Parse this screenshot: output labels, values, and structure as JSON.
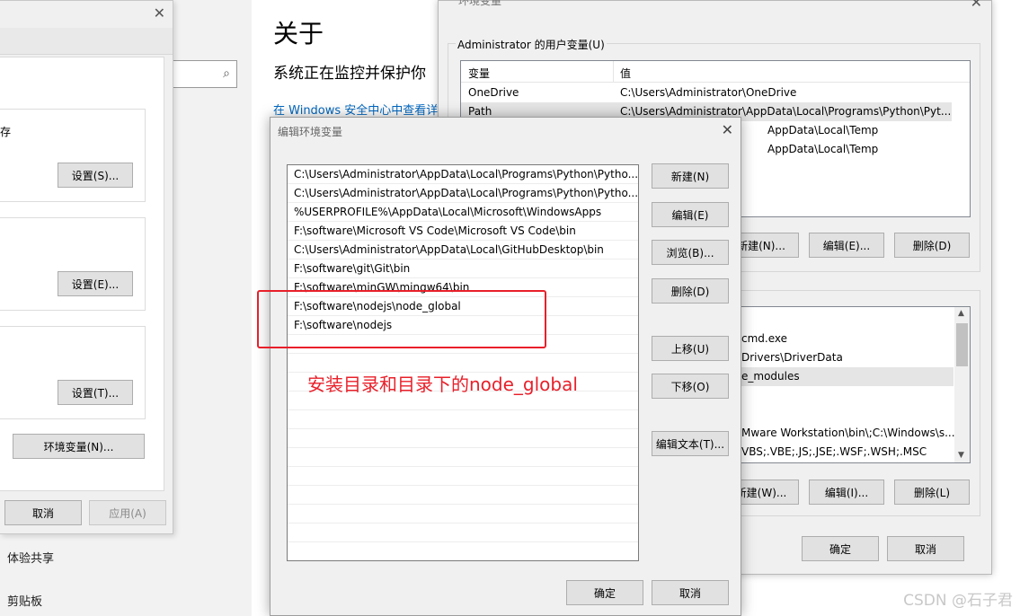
{
  "settings_left": {
    "partial_label_1": "存",
    "settings_buttons": [
      "设置(S)...",
      "设置(E)...",
      "设置(T)..."
    ],
    "env_button": "环境变量(N)...",
    "cancel": "取消",
    "apply": "应用(A)",
    "nav_items": [
      "体验共享",
      "剪贴板"
    ]
  },
  "about": {
    "title": "关于",
    "subtitle": "系统正在监控并保护你",
    "link": "在 Windows 安全中心中查看详"
  },
  "env_dialog": {
    "title": "环境变量",
    "user_vars_label": "Administrator 的用户变量(U)",
    "columns": [
      "变量",
      "值"
    ],
    "user_vars": [
      {
        "name": "OneDrive",
        "value": "C:\\Users\\Administrator\\OneDrive"
      },
      {
        "name": "Path",
        "value": "C:\\Users\\Administrator\\AppData\\Local\\Programs\\Python\\Pyt..."
      },
      {
        "name": "",
        "value": "AppData\\Local\\Temp"
      },
      {
        "name": "",
        "value": "AppData\\Local\\Temp"
      }
    ],
    "user_buttons": [
      "新建(N)...",
      "编辑(E)...",
      "删除(D)"
    ],
    "sys_vars_partial": [
      "cmd.exe",
      "Drivers\\DriverData",
      "e_modules",
      "",
      "",
      "Mware Workstation\\bin\\;C:\\Windows\\s...",
      "VBS;.VBE;.JS;.JSE;.WSF;.WSH;.MSC"
    ],
    "sys_buttons": [
      "新建(W)...",
      "编辑(I)...",
      "删除(L)"
    ],
    "ok": "确定",
    "cancel": "取消"
  },
  "edit_dialog": {
    "title": "编辑环境变量",
    "paths": [
      "C:\\Users\\Administrator\\AppData\\Local\\Programs\\Python\\Pytho...",
      "C:\\Users\\Administrator\\AppData\\Local\\Programs\\Python\\Pytho...",
      "%USERPROFILE%\\AppData\\Local\\Microsoft\\WindowsApps",
      "F:\\software\\Microsoft VS Code\\Microsoft VS Code\\bin",
      "C:\\Users\\Administrator\\AppData\\Local\\GitHubDesktop\\bin",
      "F:\\software\\git\\Git\\bin",
      "F:\\software\\minGW\\mingw64\\bin",
      "F:\\software\\nodejs\\node_global",
      "F:\\software\\nodejs"
    ],
    "buttons": [
      "新建(N)",
      "编辑(E)",
      "浏览(B)...",
      "删除(D)",
      "上移(U)",
      "下移(O)",
      "编辑文本(T)..."
    ],
    "ok": "确定",
    "cancel": "取消"
  },
  "annotation": "安装目录和目录下的node_global",
  "watermark": "CSDN @石子君",
  "colors": {
    "annotation_red": "#e8202a",
    "link_blue": "#0067c0",
    "focus_blue": "#0078d7"
  }
}
